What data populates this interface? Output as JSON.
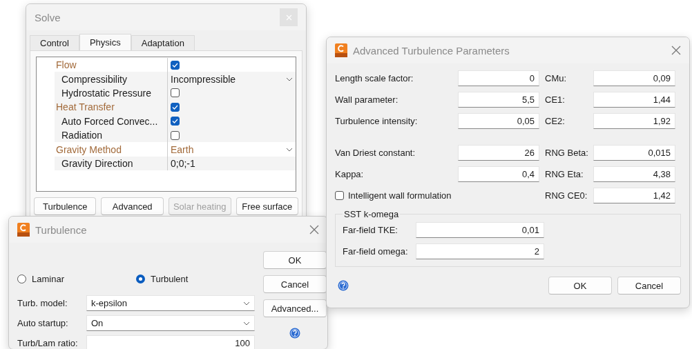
{
  "solve": {
    "title": "Solve",
    "tabs": [
      {
        "label": "Control",
        "selected": false
      },
      {
        "label": "Physics",
        "selected": true
      },
      {
        "label": "Adaptation",
        "selected": false
      }
    ],
    "properties": [
      {
        "label": "Flow",
        "field": {
          "kind": "checkbox",
          "checked": true
        },
        "children": [
          {
            "label": "Compressibility",
            "field": {
              "kind": "dropdown",
              "value": "Incompressible"
            }
          },
          {
            "label": "Hydrostatic Pressure",
            "field": {
              "kind": "checkbox",
              "checked": false
            }
          }
        ]
      },
      {
        "label": "Heat Transfer",
        "field": {
          "kind": "checkbox",
          "checked": true
        },
        "children": [
          {
            "label": "Auto Forced Convec...",
            "field": {
              "kind": "checkbox",
              "checked": true
            }
          },
          {
            "label": "Radiation",
            "field": {
              "kind": "checkbox",
              "checked": false
            }
          }
        ]
      },
      {
        "label": "Gravity Method",
        "field": {
          "kind": "dropdown",
          "value": "Earth"
        },
        "children": [
          {
            "label": "Gravity Direction",
            "field": {
              "kind": "text",
              "value": "0;0;-1"
            }
          }
        ]
      }
    ],
    "buttons": [
      {
        "label": "Turbulence",
        "disabled": false
      },
      {
        "label": "Advanced",
        "disabled": false
      },
      {
        "label": "Solar heating",
        "disabled": true
      },
      {
        "label": "Free surface",
        "disabled": false
      }
    ]
  },
  "turbulence": {
    "title": "Turbulence",
    "radios": [
      {
        "label": "Laminar",
        "selected": false
      },
      {
        "label": "Turbulent",
        "selected": true
      }
    ],
    "fields": [
      {
        "label": "Turb. model:",
        "kind": "dropdown",
        "value": "k-epsilon"
      },
      {
        "label": "Auto startup:",
        "kind": "dropdown",
        "value": "On"
      },
      {
        "label": "Turb/Lam ratio:",
        "kind": "text",
        "value": "100"
      }
    ],
    "buttons": [
      "OK",
      "Cancel",
      "Advanced..."
    ]
  },
  "advanced": {
    "title": "Advanced Turbulence Parameters",
    "groups": [
      [
        {
          "left": {
            "kind": "field",
            "label": "Length scale factor:",
            "value": "0"
          },
          "right": {
            "label": "CMu:",
            "value": "0,09"
          }
        },
        {
          "left": {
            "kind": "field",
            "label": "Wall parameter:",
            "value": "5,5"
          },
          "right": {
            "label": "CE1:",
            "value": "1,44"
          }
        },
        {
          "left": {
            "kind": "field",
            "label": "Turbulence intensity:",
            "value": "0,05"
          },
          "right": {
            "label": "CE2:",
            "value": "1,92"
          }
        }
      ],
      [
        {
          "left": {
            "kind": "field",
            "label": "Van Driest constant:",
            "value": "26"
          },
          "right": {
            "label": "RNG Beta:",
            "value": "0,015"
          }
        },
        {
          "left": {
            "kind": "field",
            "label": "Kappa:",
            "value": "0,4"
          },
          "right": {
            "label": "RNG Eta:",
            "value": "4,38"
          }
        },
        {
          "left": {
            "kind": "checkbox",
            "label": "Intelligent wall formulation",
            "checked": false
          },
          "right": {
            "label": "RNG CE0:",
            "value": "1,42"
          }
        }
      ]
    ],
    "sst": {
      "title": "SST k-omega",
      "fields": [
        {
          "label": "Far-field TKE:",
          "value": "0,01"
        },
        {
          "label": "Far-field omega:",
          "value": "2"
        }
      ]
    },
    "buttons": [
      "OK",
      "Cancel"
    ]
  }
}
